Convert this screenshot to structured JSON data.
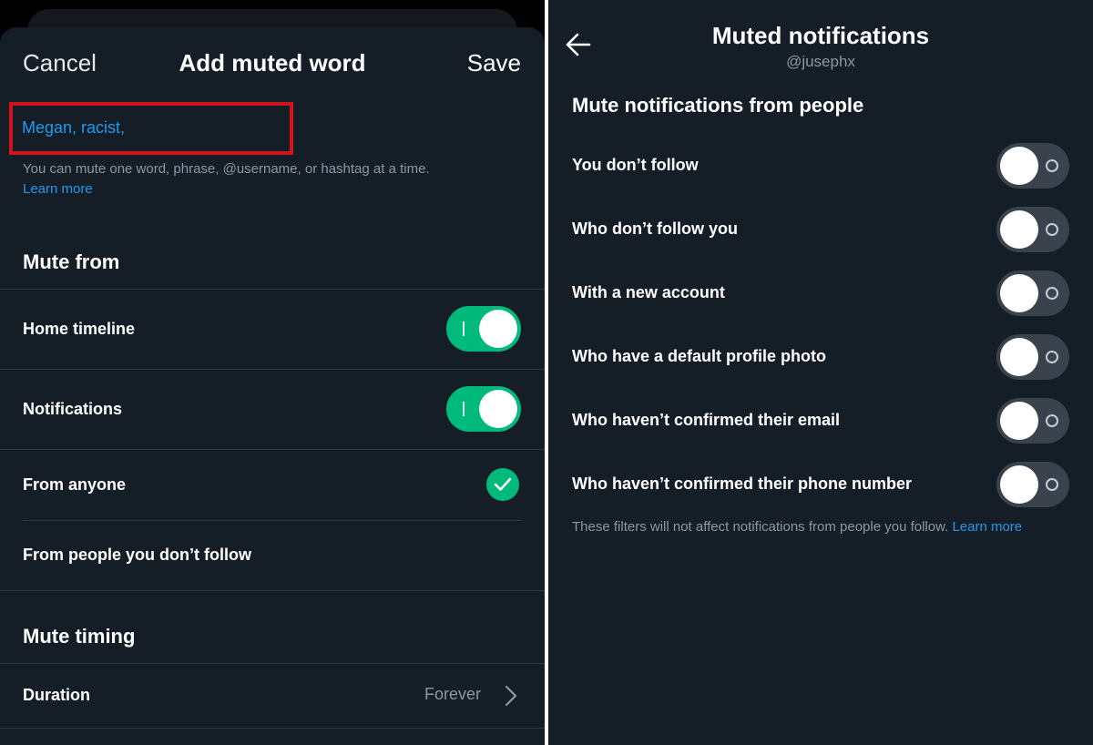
{
  "left": {
    "header": {
      "cancel": "Cancel",
      "title": "Add muted word",
      "save": "Save"
    },
    "input": {
      "value": "Megan, racist,",
      "helper": "You can mute one word, phrase, @username, or hashtag at a time.",
      "learn_more": "Learn more"
    },
    "mute_from": {
      "title": "Mute from",
      "rows": [
        {
          "label": "Home timeline",
          "control": "toggle",
          "on": true
        },
        {
          "label": "Notifications",
          "control": "toggle",
          "on": true
        },
        {
          "label": "From anyone",
          "control": "check",
          "checked": true
        },
        {
          "label": "From people you don’t follow",
          "control": "none"
        }
      ]
    },
    "mute_timing": {
      "title": "Mute timing",
      "duration_label": "Duration",
      "duration_value": "Forever"
    }
  },
  "right": {
    "header": {
      "title": "Muted notifications",
      "handle": "@jusephx"
    },
    "section_title": "Mute notifications from people",
    "rows": [
      {
        "label": "You don’t follow",
        "on": false
      },
      {
        "label": "Who don’t follow you",
        "on": false
      },
      {
        "label": "With a new account",
        "on": false
      },
      {
        "label": "Who have a default profile photo",
        "on": false
      },
      {
        "label": "Who haven’t confirmed their email",
        "on": false
      },
      {
        "label": "Who haven’t confirmed their phone number",
        "on": false
      }
    ],
    "footer": {
      "text": "These filters will not affect notifications from people you follow.",
      "link": "Learn more"
    }
  },
  "colors": {
    "accent_green": "#00ba7c",
    "link_blue": "#1d9bf0",
    "highlight_red": "#d0141c",
    "background": "#151d27"
  },
  "icons": [
    "back-arrow-icon",
    "checkmark-icon",
    "chevron-right-icon",
    "toggle-off-ring-icon",
    "toggle-on-bar-icon"
  ]
}
